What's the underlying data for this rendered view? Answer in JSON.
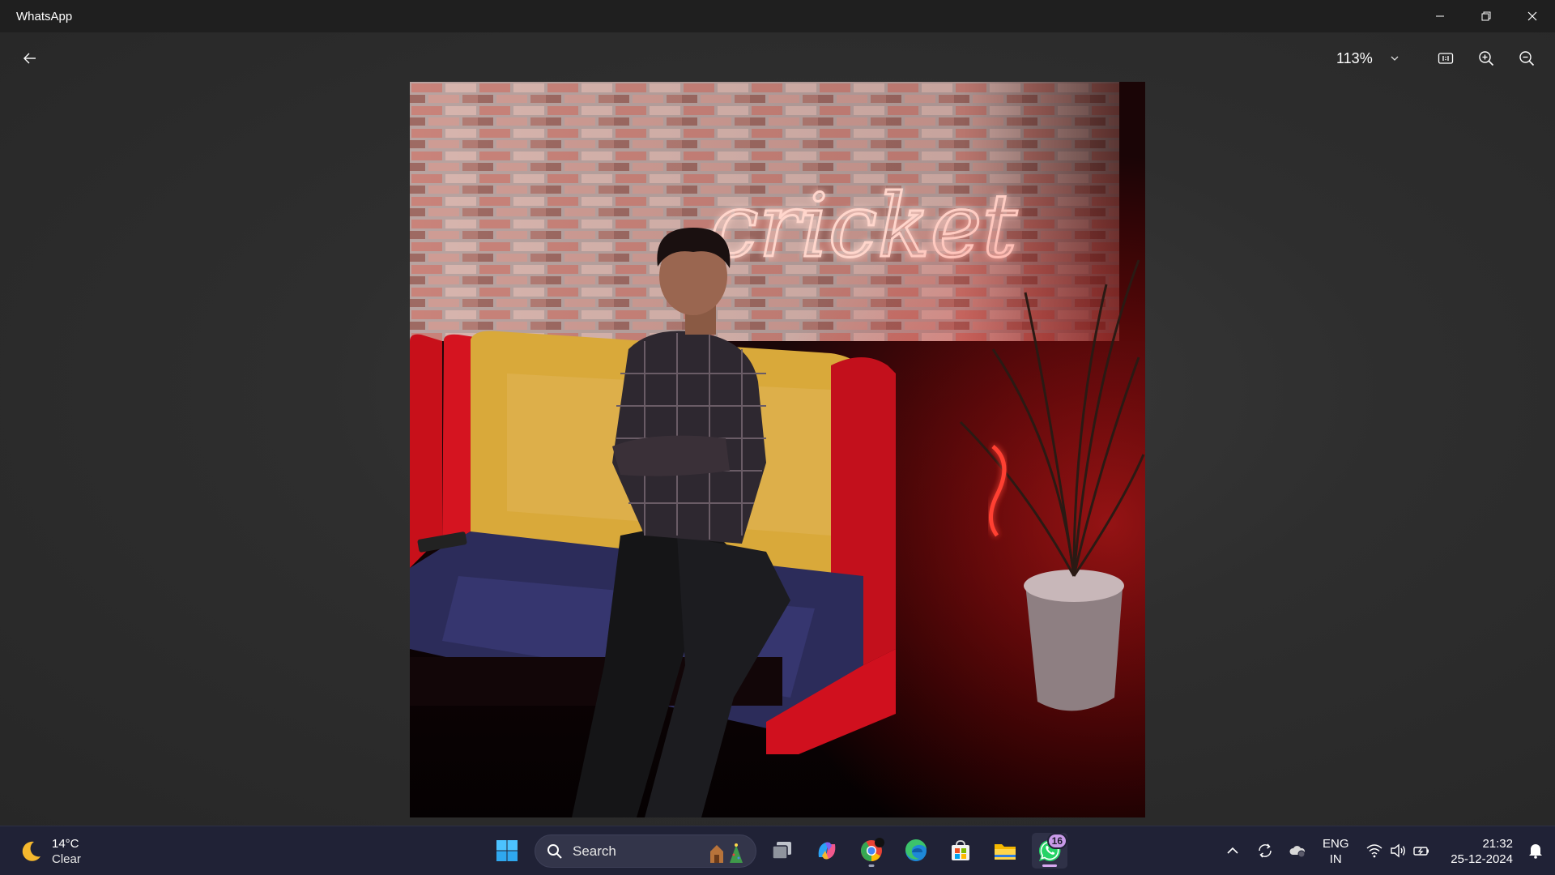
{
  "window": {
    "title": "WhatsApp",
    "controls": [
      "minimize-icon",
      "restore-icon",
      "close-icon"
    ]
  },
  "viewer": {
    "back_icon": "back-arrow-icon",
    "zoom_level": "113%",
    "zoom_dropdown_icon": "chevron-down-icon",
    "tools": [
      "actual-size-icon",
      "zoom-in-icon",
      "zoom-out-icon"
    ],
    "photo": {
      "neon_sign_text": "cricket"
    }
  },
  "taskbar": {
    "weather": {
      "temperature": "14°C",
      "condition": "Clear",
      "icon": "moon-icon"
    },
    "search": {
      "label": "Search"
    },
    "apps": [
      {
        "name": "start",
        "icon": "windows-start-icon"
      },
      {
        "name": "task-view",
        "icon": "task-view-icon"
      },
      {
        "name": "copilot",
        "icon": "copilot-icon"
      },
      {
        "name": "chrome",
        "icon": "chrome-icon"
      },
      {
        "name": "edge",
        "icon": "edge-icon"
      },
      {
        "name": "store",
        "icon": "store-icon"
      },
      {
        "name": "file-explorer",
        "icon": "folder-icon"
      },
      {
        "name": "whatsapp",
        "icon": "whatsapp-icon",
        "badge": "16"
      }
    ],
    "tray": {
      "language_line1": "ENG",
      "language_line2": "IN",
      "time": "21:32",
      "date": "25-12-2024"
    }
  },
  "colors": {
    "titlebar_bg": "#1f1f1f",
    "viewer_bg": "#2e2e2e",
    "taskbar_bg": "#202236",
    "accent_badge": "#c89ae8"
  }
}
